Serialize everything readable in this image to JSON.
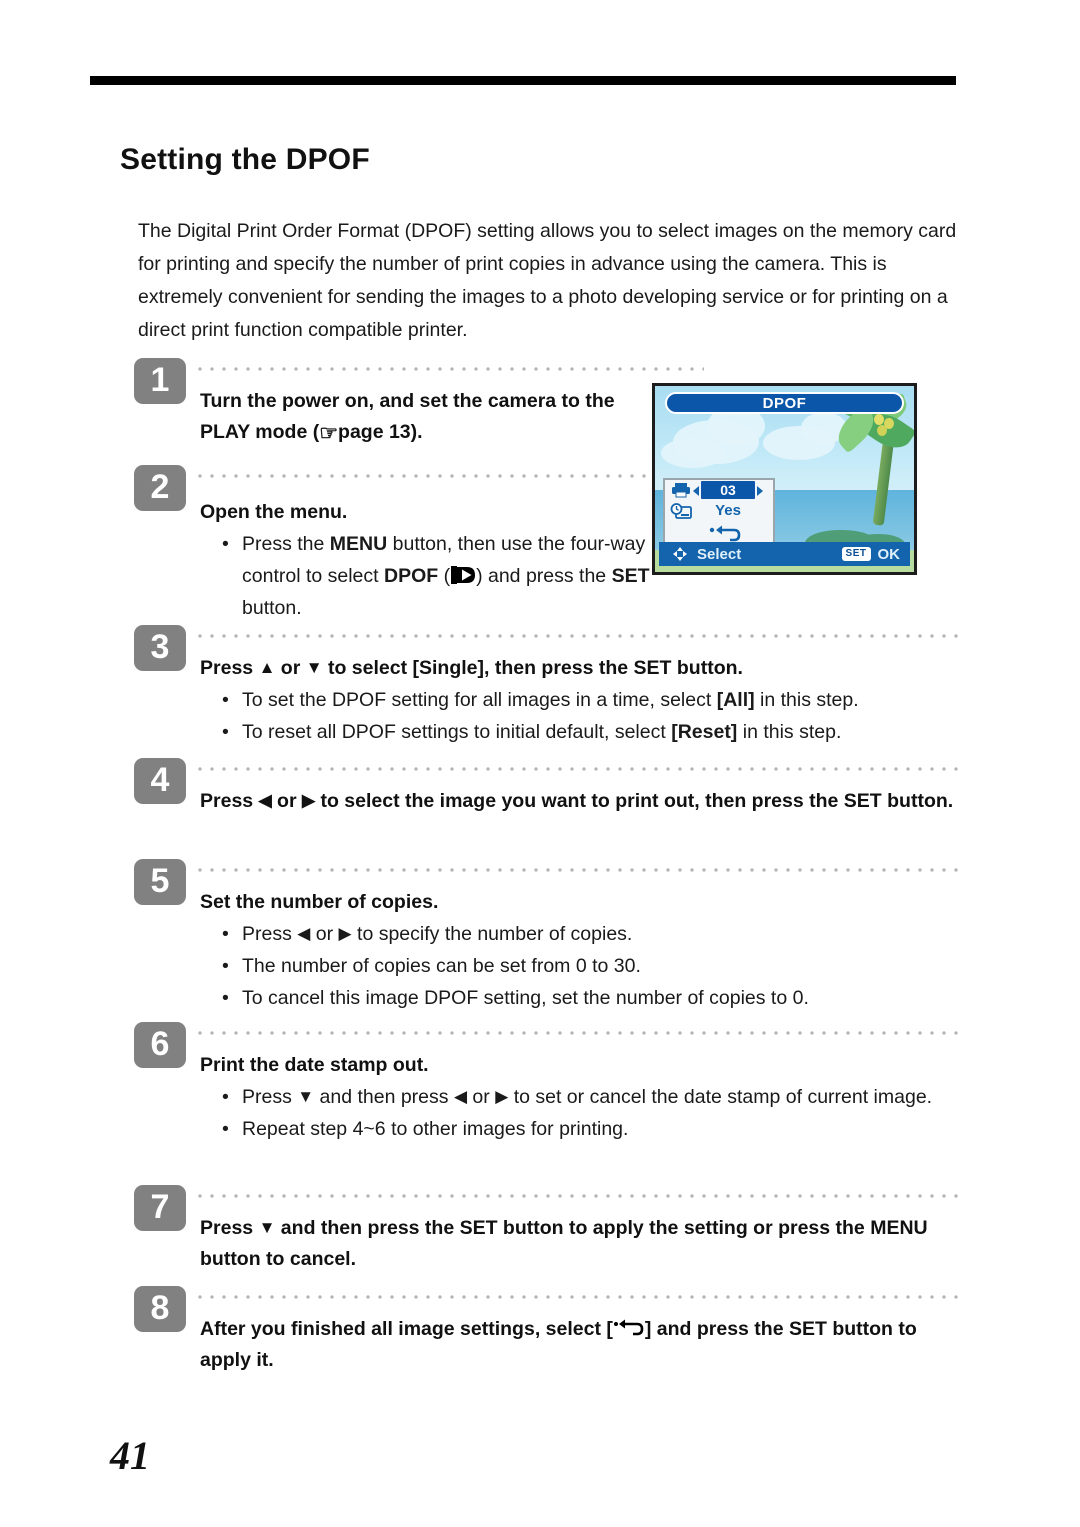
{
  "document": {
    "heading": "Setting the DPOF",
    "intro": "The Digital Print Order Format (DPOF) setting allows you to select images on the memory card for printing and specify the number of print copies in advance using the camera. This is extremely convenient for sending the images to a photo developing service or for printing on a direct print function compatible printer.",
    "page_number": "41"
  },
  "steps": [
    {
      "number": "1",
      "title_pre": "Turn the power on, and set the camera to the PLAY mode (",
      "title_post": "page 13).",
      "bullets": []
    },
    {
      "number": "2",
      "title": "Open the menu.",
      "bullets": [
        {
          "bullet": "•",
          "pre": "Press the ",
          "bold1": "MENU",
          "mid": " button, then use the four-way control to select ",
          "bold2": "DPOF",
          "mid2": " (",
          "post": ") and press the ",
          "bold3": "SET",
          "tail": " button."
        }
      ]
    },
    {
      "number": "3",
      "title_a": "Press ",
      "title_b": " or ",
      "title_c": " to select [Single], then press the SET button.",
      "bullets": [
        {
          "bullet": "•",
          "pre": "To set the DPOF setting for all images in a time, select ",
          "bold": "[All]",
          "post": " in this step."
        },
        {
          "bullet": "•",
          "pre": "To reset all DPOF settings to initial default, select ",
          "bold": "[Reset]",
          "post": " in this step."
        }
      ]
    },
    {
      "number": "4",
      "title_a": "Press ",
      "title_b": " or ",
      "title_c": " to select the image you want to print out, then press the SET button."
    },
    {
      "number": "5",
      "title": "Set the number of copies.",
      "bullets": [
        {
          "bullet": "•",
          "pre": "Press ",
          "mid": " or ",
          "post": " to specify the number of copies."
        },
        {
          "bullet": "•",
          "text": "The number of copies can be set from 0 to 30."
        },
        {
          "bullet": "•",
          "text": "To cancel this image DPOF setting, set the number of copies to 0."
        }
      ]
    },
    {
      "number": "6",
      "title": "Print the date stamp out.",
      "bullets": [
        {
          "bullet": "•",
          "pre": "Press ",
          "mid": " and then press ",
          "mid2": " or ",
          "post": " to set or cancel the date stamp of current image."
        },
        {
          "bullet": "•",
          "text": "Repeat step 4~6 to other images for printing."
        }
      ]
    },
    {
      "number": "7",
      "title_a": "Press ",
      "title_c": " and then press the SET button to apply the setting or press the MENU button to cancel."
    },
    {
      "number": "8",
      "title_a": "After you finished all image settings, select [",
      "title_c": "] and press the SET button to apply it."
    }
  ],
  "lcd": {
    "title": "DPOF",
    "copies_value": "03",
    "date_stamp_value": "Yes",
    "footer_select_label": "Select",
    "footer_set_badge": "SET",
    "footer_ok_label": "OK",
    "colors": {
      "title_bar": "#0b56a8",
      "footer_bar": "#1464ad",
      "highlight": "#0b56a8",
      "sky": "#a9ddf2",
      "sea": "#5fb4dd",
      "panel_bg": "#f2f6f9"
    }
  },
  "glyphs": {
    "hand_pointer": "☞",
    "up_arrow": "▲",
    "down_arrow": "▼",
    "left_arrow": "◀",
    "right_arrow": "▶"
  }
}
